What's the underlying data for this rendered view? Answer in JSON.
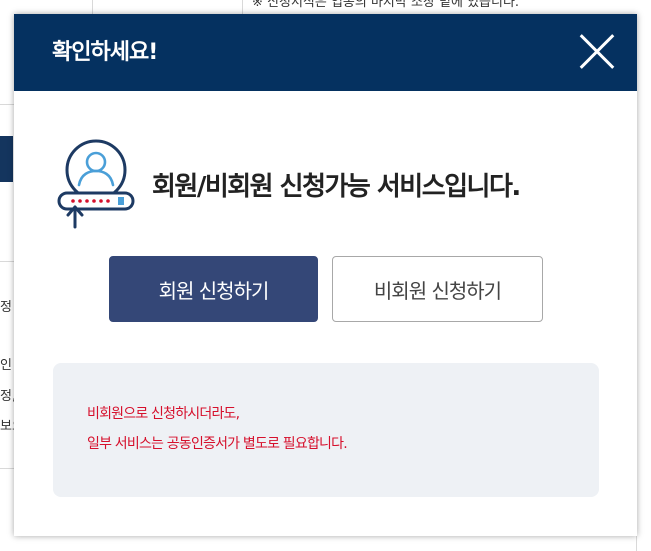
{
  "background": {
    "top_text": "※ 신청서식은 업종의 마지막 소장 밑에 있습니다.",
    "side_fragments": [
      "정",
      "인",
      "정,",
      "보으"
    ]
  },
  "modal": {
    "title": "확인하세요!",
    "close_label": "닫기",
    "headline": "회원/비회원 신청가능 서비스입니다.",
    "buttons": {
      "member": "회원 신청하기",
      "guest": "비회원 신청하기"
    },
    "notice": {
      "line1": "비회원으로 신청하시더라도,",
      "line2": "일부 서비스는 공동인증서가 별도로 필요합니다."
    }
  },
  "colors": {
    "header": "#053160",
    "primary_button": "#344777",
    "notice_text": "#d6102c",
    "notice_bg": "#eef1f5",
    "icon_dark": "#1d3a63",
    "icon_light": "#4a9fd8"
  },
  "icons": {
    "close": "close-icon",
    "service": "user-login-icon"
  }
}
